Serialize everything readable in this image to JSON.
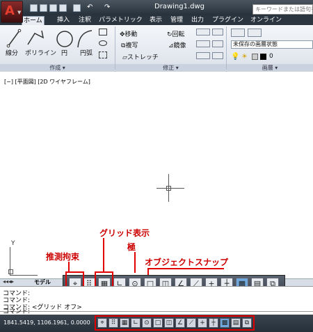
{
  "window": {
    "title": "Drawing1.dwg",
    "search_placeholder": "キーワードまたは語句を"
  },
  "tabs": [
    "ホーム",
    "挿入",
    "注釈",
    "パラメトリック",
    "表示",
    "管理",
    "出力",
    "プラグイン",
    "オンライン"
  ],
  "ribbon": {
    "draw": {
      "items": [
        "線分",
        "ポリライン",
        "円",
        "円弧"
      ],
      "title": "作成 ▾"
    },
    "modify": {
      "items": [
        "移動",
        "回転",
        "複写",
        "鏡像",
        "ストレッチ"
      ],
      "title": "修正 ▾"
    },
    "layers": {
      "state": "未保存の画層状態",
      "current": "0",
      "title": "画層 ▾"
    }
  },
  "viewport": {
    "label": "[−] [平面図] [2D ワイヤフレーム]"
  },
  "ucs": {
    "y_label": "Y"
  },
  "annotations": {
    "grid_display": "グリッド表示",
    "polar": "極",
    "object_snap": "オブジェクトスナップ",
    "infer_constraints": "推測拘束"
  },
  "layout": {
    "model_tab": "モデル"
  },
  "command": {
    "lines": [
      "コマンド:",
      "コマンド:",
      "コマンド: <グリッド オフ>"
    ],
    "prompt": "コマンド:"
  },
  "status": {
    "coordinates": "1841.5419, 1106.1961, 0.0000"
  },
  "colors": {
    "annotation": "#cc0000",
    "highlight": "#e00000"
  }
}
